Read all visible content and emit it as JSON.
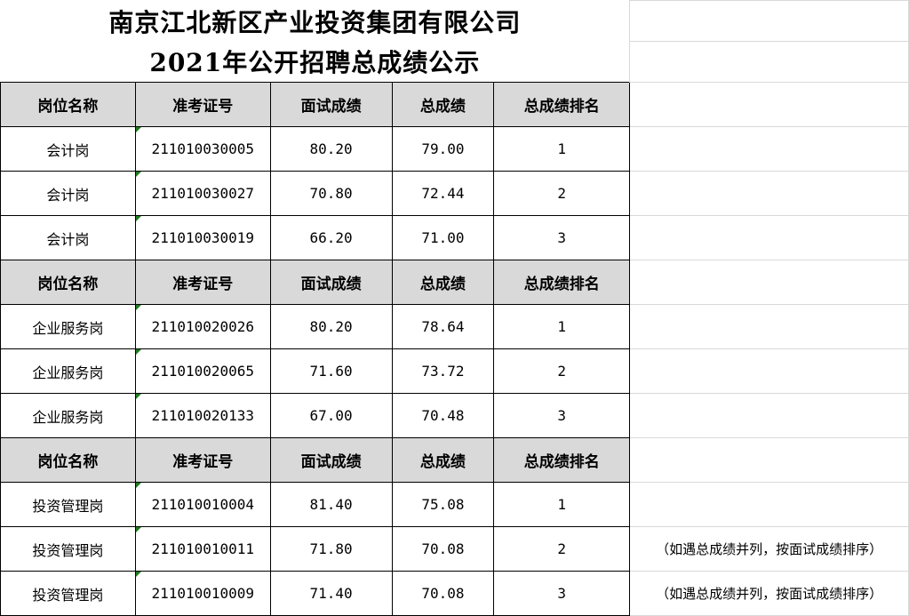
{
  "title": {
    "line1": "南京江北新区产业投资集团有限公司",
    "line2": "2021年公开招聘总成绩公示"
  },
  "columns": {
    "position": "岗位名称",
    "exam_id": "准考证号",
    "interview": "面试成绩",
    "total": "总成绩",
    "rank": "总成绩排名"
  },
  "groups": [
    {
      "rows": [
        {
          "position": "会计岗",
          "exam_id": "211010030005",
          "interview": "80.20",
          "total": "79.00",
          "rank": "1",
          "note": ""
        },
        {
          "position": "会计岗",
          "exam_id": "211010030027",
          "interview": "70.80",
          "total": "72.44",
          "rank": "2",
          "note": ""
        },
        {
          "position": "会计岗",
          "exam_id": "211010030019",
          "interview": "66.20",
          "total": "71.00",
          "rank": "3",
          "note": ""
        }
      ]
    },
    {
      "rows": [
        {
          "position": "企业服务岗",
          "exam_id": "211010020026",
          "interview": "80.20",
          "total": "78.64",
          "rank": "1",
          "note": ""
        },
        {
          "position": "企业服务岗",
          "exam_id": "211010020065",
          "interview": "71.60",
          "total": "73.72",
          "rank": "2",
          "note": ""
        },
        {
          "position": "企业服务岗",
          "exam_id": "211010020133",
          "interview": "67.00",
          "total": "70.48",
          "rank": "3",
          "note": ""
        }
      ]
    },
    {
      "rows": [
        {
          "position": "投资管理岗",
          "exam_id": "211010010004",
          "interview": "81.40",
          "total": "75.08",
          "rank": "1",
          "note": ""
        },
        {
          "position": "投资管理岗",
          "exam_id": "211010010011",
          "interview": "71.80",
          "total": "70.08",
          "rank": "2",
          "note": "（如遇总成绩并列，按面试成绩排序）"
        },
        {
          "position": "投资管理岗",
          "exam_id": "211010010009",
          "interview": "71.40",
          "total": "70.08",
          "rank": "3",
          "note": "（如遇总成绩并列，按面试成绩排序）"
        }
      ]
    }
  ]
}
